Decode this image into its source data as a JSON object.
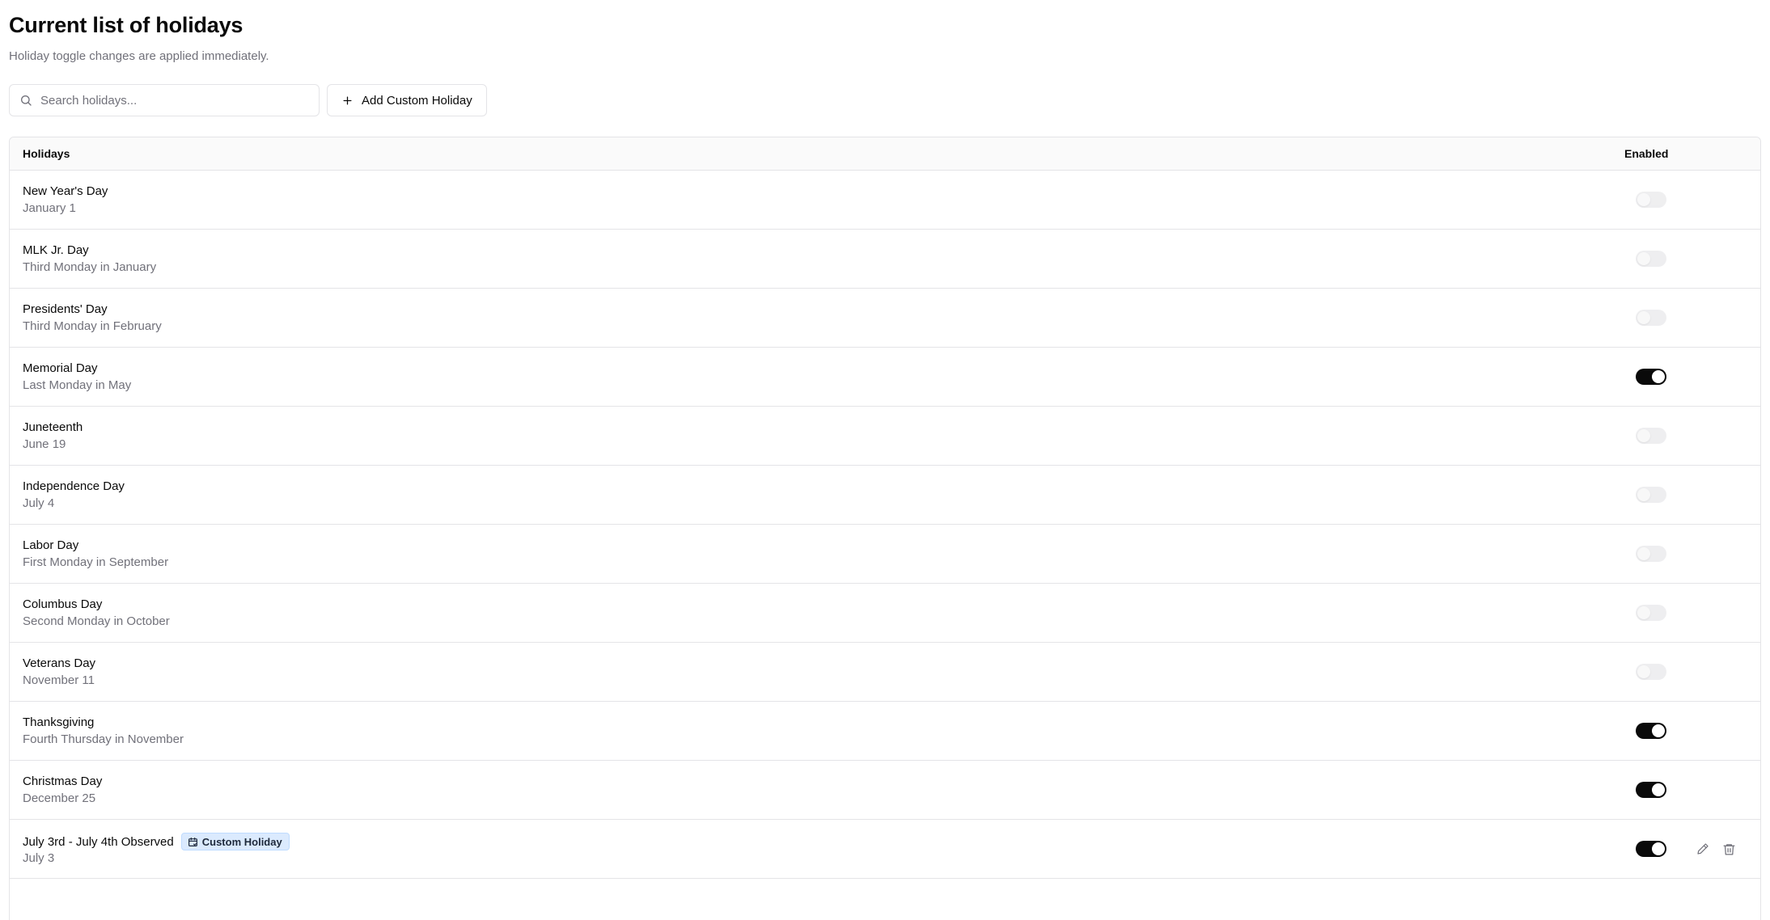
{
  "page": {
    "title": "Current list of holidays",
    "subtitle": "Holiday toggle changes are applied immediately."
  },
  "toolbar": {
    "search_placeholder": "Search holidays...",
    "search_value": "",
    "add_label": "Add Custom Holiday"
  },
  "table": {
    "headers": {
      "holidays": "Holidays",
      "enabled": "Enabled"
    },
    "rows": [
      {
        "name": "New Year's Day",
        "date": "January 1",
        "enabled": false
      },
      {
        "name": "MLK Jr. Day",
        "date": "Third Monday in January",
        "enabled": false
      },
      {
        "name": "Presidents' Day",
        "date": "Third Monday in February",
        "enabled": false
      },
      {
        "name": "Memorial Day",
        "date": "Last Monday in May",
        "enabled": true
      },
      {
        "name": "Juneteenth",
        "date": "June 19",
        "enabled": false
      },
      {
        "name": "Independence Day",
        "date": "July 4",
        "enabled": false
      },
      {
        "name": "Labor Day",
        "date": "First Monday in September",
        "enabled": false
      },
      {
        "name": "Columbus Day",
        "date": "Second Monday in October",
        "enabled": false
      },
      {
        "name": "Veterans Day",
        "date": "November 11",
        "enabled": false
      },
      {
        "name": "Thanksgiving",
        "date": "Fourth Thursday in November",
        "enabled": true
      },
      {
        "name": "Christmas Day",
        "date": "December 25",
        "enabled": true
      },
      {
        "name": "July 3rd - July 4th Observed",
        "date": "July 3",
        "enabled": true,
        "custom": true,
        "badge": "Custom Holiday"
      }
    ]
  },
  "icons": {
    "search": "search-icon",
    "add": "plus-icon",
    "badge": "calendar-icon",
    "edit": "pencil-icon",
    "delete": "trash-icon"
  },
  "colors": {
    "toggle_on": "#0a0a0a",
    "toggle_off": "#e4e4e7",
    "badge_bg": "#dbeafe",
    "muted_text": "#71717a",
    "border": "#e4e4e7"
  }
}
